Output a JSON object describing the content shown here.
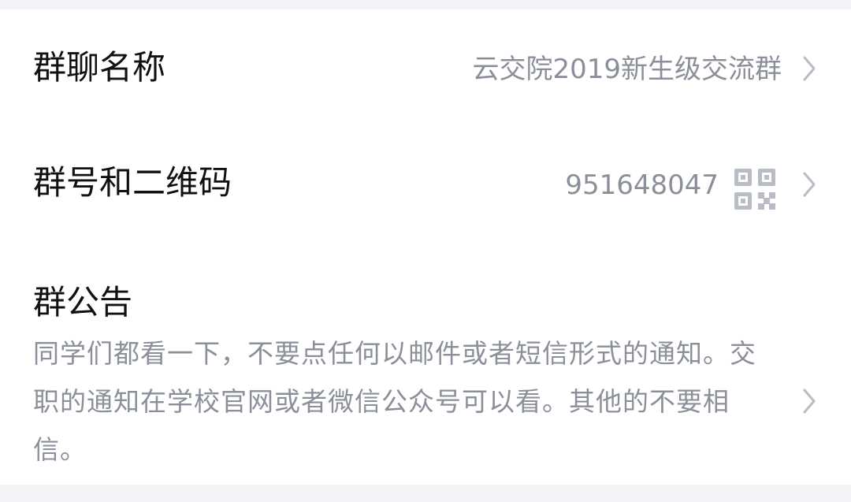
{
  "group_settings": {
    "group_name": {
      "label": "群聊名称",
      "value": "云交院2019新生级交流群"
    },
    "group_id": {
      "label": "群号和二维码",
      "value": "951648047",
      "icon": "qr-code-icon"
    },
    "announcement": {
      "label": "群公告",
      "text": "同学们都看一下，不要点任何以邮件或者短信形式的通知。交职的通知在学校官网或者微信公众号可以看。其他的不要相信。"
    }
  },
  "colors": {
    "background": "#f2f3f7",
    "card": "#ffffff",
    "label": "#111111",
    "secondary": "#8a8f99",
    "chevron": "#b8bcc4"
  }
}
